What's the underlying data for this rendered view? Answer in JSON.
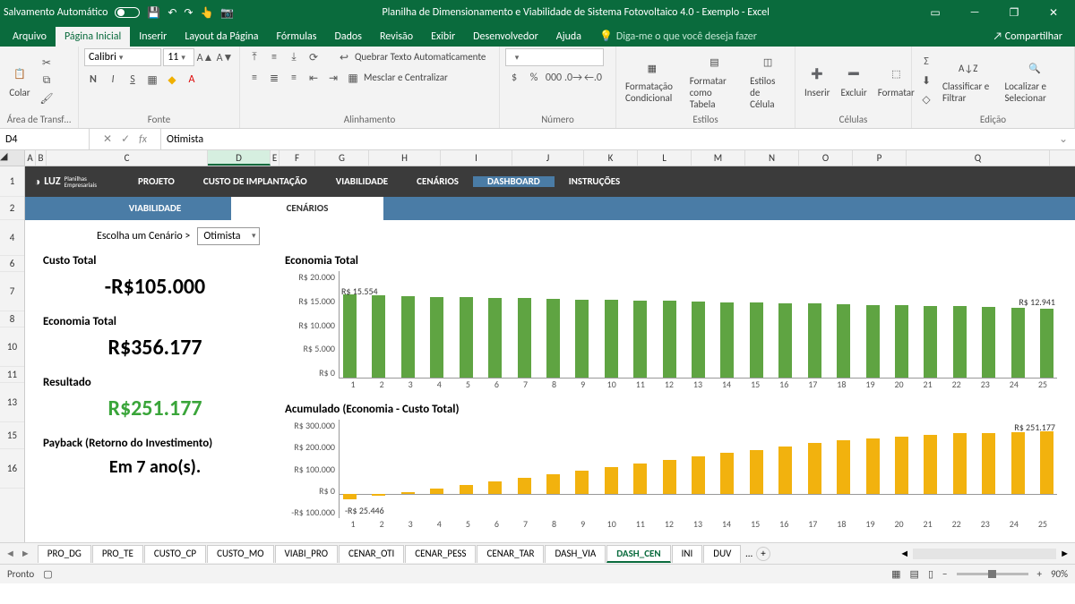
{
  "titlebar": {
    "autosave": "Salvamento Automático",
    "title": "Planilha de Dimensionamento e Viabilidade de Sistema Fotovoltaico 4.0 - Exemplo  -  Excel"
  },
  "menutabs": {
    "file": "Arquivo",
    "home": "Página Inicial",
    "insert": "Inserir",
    "layout": "Layout da Página",
    "formulas": "Fórmulas",
    "data": "Dados",
    "review": "Revisão",
    "view": "Exibir",
    "developer": "Desenvolvedor",
    "help": "Ajuda",
    "tell": "Diga-me o que você deseja fazer",
    "share": "Compartilhar"
  },
  "ribbon": {
    "paste": "Colar",
    "clipboard": "Área de Transf…",
    "font_name": "Calibri",
    "font_size": "11",
    "font": "Fonte",
    "wrap": "Quebrar Texto Automaticamente",
    "merge": "Mesclar e Centralizar",
    "alignment": "Alinhamento",
    "number": "Número",
    "cond": "Formatação Condicional",
    "table": "Formatar como Tabela",
    "cell_styles": "Estilos de Célula",
    "styles": "Estilos",
    "insert": "Inserir",
    "delete": "Excluir",
    "format": "Formatar",
    "cells": "Células",
    "sort": "Classificar e Filtrar",
    "find": "Localizar e Selecionar",
    "editing": "Edição"
  },
  "fx": {
    "name": "D4",
    "formula": "Otimista"
  },
  "cols": [
    "A",
    "B",
    "C",
    "D",
    "E",
    "F",
    "G",
    "H",
    "I",
    "J",
    "K",
    "L",
    "M",
    "N",
    "O",
    "P",
    "Q"
  ],
  "rows": [
    "1",
    "2",
    "4",
    "6",
    "7",
    "8",
    "10",
    "11",
    "13",
    "15",
    "16"
  ],
  "dashboard": {
    "logo": "LUZ",
    "logo_sub": "Planilhas Empresariais",
    "nav": {
      "projeto": "PROJETO",
      "custo": "CUSTO DE IMPLANTAÇÃO",
      "viab": "VIABILIDADE",
      "cenarios": "CENÁRIOS",
      "dash": "DASHBOARD",
      "instr": "INSTRUÇÕES"
    },
    "subnav": {
      "viab": "VIABILIDADE",
      "cenarios": "CENÁRIOS"
    },
    "picker_label": "Escolha um Cenário >",
    "picker_value": "Otimista",
    "cards": {
      "custo_title": "Custo Total",
      "custo_value": "-R$105.000",
      "econ_title": "Economia Total",
      "econ_value": "R$356.177",
      "res_title": "Resultado",
      "res_value": "R$251.177",
      "payback_title": "Payback (Retorno do Investimento)",
      "payback_value": "Em 7 ano(s)."
    },
    "chart1_title": "Economia Total",
    "chart2_title": "Acumulado (Economia - Custo Total)",
    "label_first": "R$ 15.554",
    "label_last": "R$ 12.941",
    "label_acc_first": "-R$ 25.446",
    "label_acc_last": "R$ 251.177"
  },
  "chart_data": [
    {
      "type": "bar",
      "title": "Economia Total",
      "categories": [
        1,
        2,
        3,
        4,
        5,
        6,
        7,
        8,
        9,
        10,
        11,
        12,
        13,
        14,
        15,
        16,
        17,
        18,
        19,
        20,
        21,
        22,
        23,
        24,
        25
      ],
      "values": [
        15554,
        15400,
        15300,
        15200,
        15100,
        15000,
        14900,
        14800,
        14700,
        14600,
        14500,
        14400,
        14300,
        14200,
        14100,
        14000,
        13900,
        13800,
        13700,
        13600,
        13500,
        13400,
        13300,
        13100,
        12941
      ],
      "ylabel": "R$",
      "ylim": [
        0,
        20000
      ],
      "yticks": [
        "R$ 0",
        "R$ 5.000",
        "R$ 10.000",
        "R$ 15.000",
        "R$ 20.000"
      ]
    },
    {
      "type": "bar",
      "title": "Acumulado (Economia - Custo Total)",
      "categories": [
        1,
        2,
        3,
        4,
        5,
        6,
        7,
        8,
        9,
        10,
        11,
        12,
        13,
        14,
        15,
        16,
        17,
        18,
        19,
        20,
        21,
        22,
        23,
        24,
        25
      ],
      "values": [
        -25446,
        -10000,
        5000,
        20000,
        35000,
        50000,
        64000,
        79000,
        93000,
        108000,
        122000,
        136000,
        150000,
        164000,
        178000,
        192000,
        206000,
        215000,
        225000,
        232000,
        239000,
        244000,
        247000,
        249000,
        251177
      ],
      "ylabel": "R$",
      "ylim": [
        -100000,
        300000
      ],
      "yticks": [
        "-R$ 100.000",
        "R$ 0",
        "R$ 100.000",
        "R$ 200.000",
        "R$ 300.000"
      ]
    }
  ],
  "sheet_tabs": [
    "PRO_DG",
    "PRO_TE",
    "CUSTO_CP",
    "CUSTO_MO",
    "VIABI_PRO",
    "CENAR_OTI",
    "CENAR_PESS",
    "CENAR_TAR",
    "DASH_VIA",
    "DASH_CEN",
    "INI",
    "DUV"
  ],
  "sheet_tabs_more": "…",
  "status": {
    "ready": "Pronto",
    "zoom": "90%"
  }
}
